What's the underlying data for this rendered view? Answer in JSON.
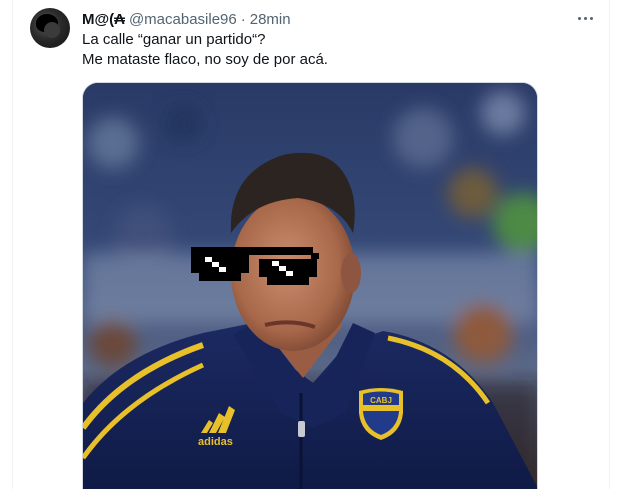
{
  "tweet": {
    "author_name": "M@(₳",
    "handle": "@macabasile96",
    "separator": "·",
    "time": "28min",
    "text_lines": [
      "La calle “ganar un partido“?",
      "Me mataste flaco, no soy de por acá."
    ],
    "more_icon": "more-horizontal-icon"
  },
  "media": {
    "shirt_badge_text": "CABJ",
    "brand": "adidas"
  }
}
